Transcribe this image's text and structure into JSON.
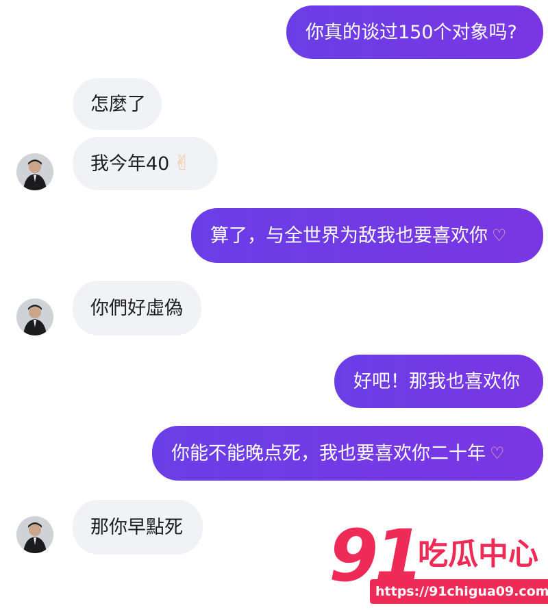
{
  "messages": [
    {
      "id": "m1",
      "side": "outgoing",
      "text": "你真的谈过150个对象吗?"
    },
    {
      "id": "m2",
      "side": "incoming",
      "text": "怎麼了"
    },
    {
      "id": "m3",
      "side": "incoming",
      "text": "我今年40",
      "emoji": "victory-hand-emoji"
    },
    {
      "id": "m4",
      "side": "outgoing",
      "text": "算了，与全世界为敌我也要喜欢你",
      "emoji": "heart-hands-emoji"
    },
    {
      "id": "m5",
      "side": "incoming",
      "text": "你們好虛偽"
    },
    {
      "id": "m6",
      "side": "outgoing",
      "text": "好吧！那我也喜欢你"
    },
    {
      "id": "m7",
      "side": "outgoing",
      "text": "你能不能晚点死，我也要喜欢你二十年",
      "emoji": "heart-hands-emoji"
    },
    {
      "id": "m8",
      "side": "incoming",
      "text": "那你早點死"
    }
  ],
  "watermark": {
    "number": "91",
    "title": "吃瓜中心",
    "url": "https://91chigua09.com"
  },
  "colors": {
    "outgoing_bubble": "#6f3ce6",
    "incoming_bubble": "#f0f2f6",
    "watermark": "#ee2a56"
  }
}
